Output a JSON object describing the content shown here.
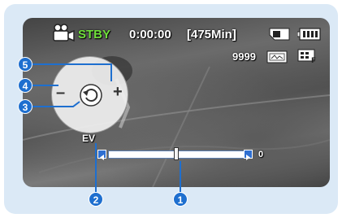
{
  "status": {
    "mode": "STBY",
    "timecode": "0:00:00",
    "remaining": "[475Min]",
    "photo_count": "9999"
  },
  "icons": {
    "camcorder": "video-camera-icon",
    "storage": "memory-card-icon",
    "battery": "battery-icon",
    "photo_size": "photo-resolution-icon",
    "quality": "quality-fine-icon",
    "back": "return-icon"
  },
  "dial": {
    "minus": "–",
    "plus": "+"
  },
  "ev": {
    "label": "EV",
    "value": "0",
    "level": 0.5
  },
  "callouts": [
    "1",
    "2",
    "3",
    "4",
    "5"
  ],
  "colors": {
    "accent": "#1e6fcf",
    "standby": "#6fe03a",
    "frame": "#dbe9f6"
  }
}
